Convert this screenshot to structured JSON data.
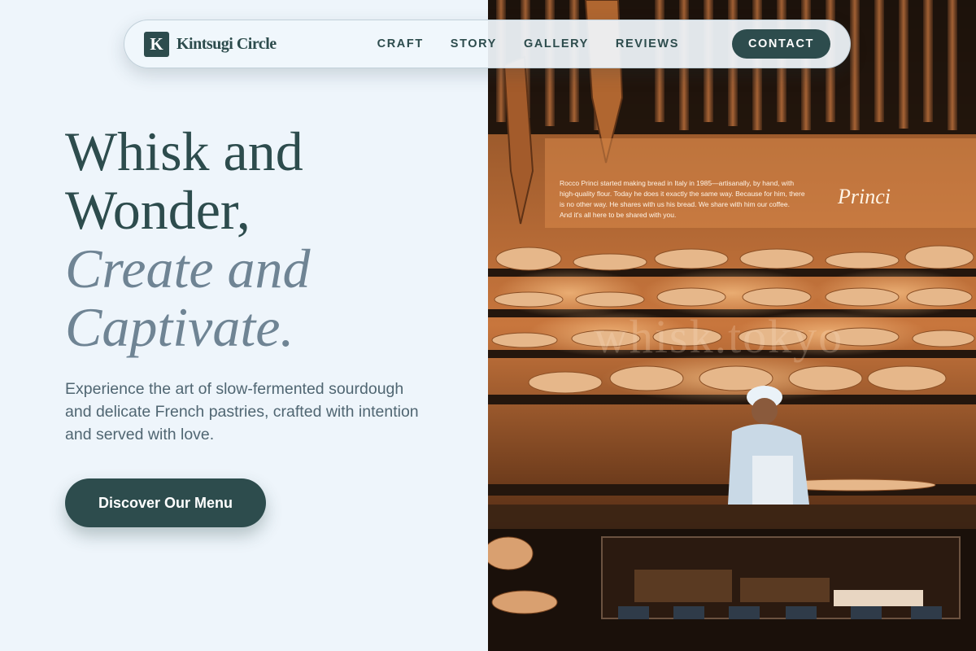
{
  "brand": {
    "mark": "K",
    "name": "Kintsugi Circle"
  },
  "nav": {
    "links": [
      "CRAFT",
      "STORY",
      "GALLERY",
      "REVIEWS"
    ],
    "contact": "CONTACT"
  },
  "hero": {
    "title_line1": "Whisk and",
    "title_line2": "Wonder,",
    "title_line3": "Create and",
    "title_line4": "Captivate.",
    "subtitle": "Experience the art of slow-fermented sourdough and delicate French pastries, crafted with intention and served with love.",
    "cta": "Discover Our Menu"
  },
  "photo": {
    "sign_text": [
      "Rocco Princi started making bread in Italy in 1985—artisanally, by hand, with",
      "high-quality flour. Today he does it exactly the same way. Because for him, there",
      "is no other way. He shares with us his bread. We share with him our coffee.",
      "And it's all here to be shared with you."
    ],
    "signature": "Princi",
    "watermark": "whisk.tokyo"
  },
  "colors": {
    "primary": "#2d4c4d",
    "accent_text": "#6f8494",
    "background": "#eef5fb"
  }
}
